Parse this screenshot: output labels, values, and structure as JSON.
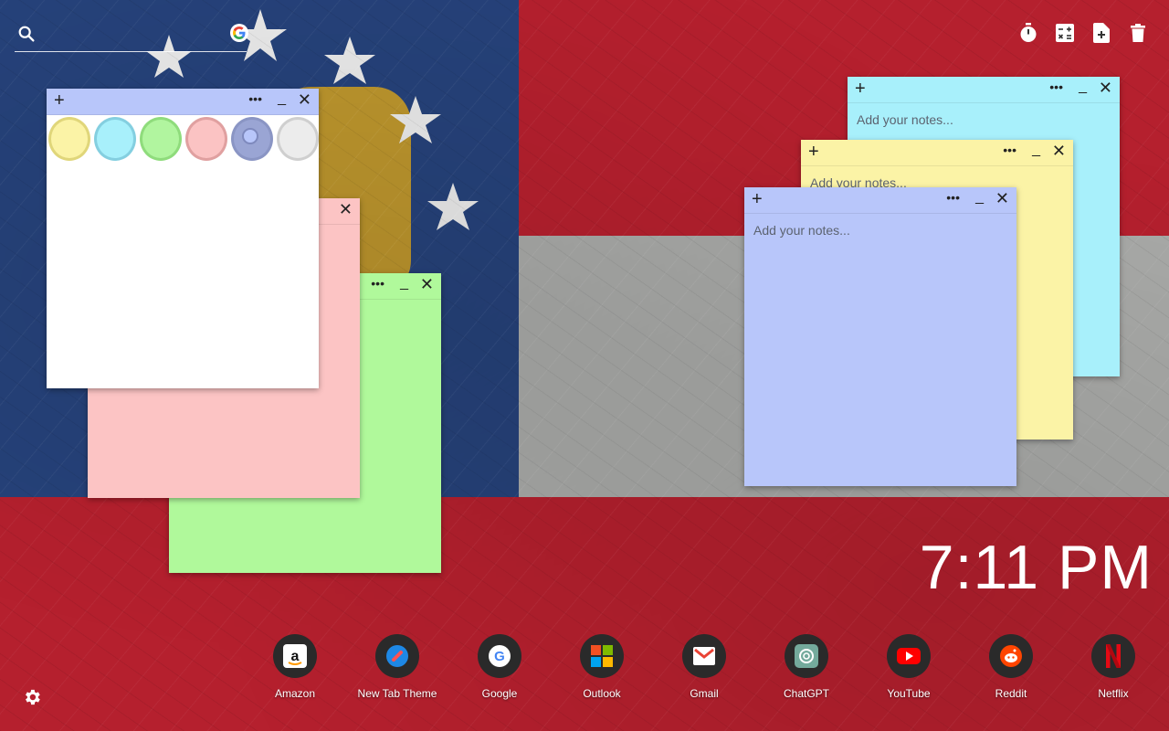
{
  "search": {
    "placeholder": "",
    "value": ""
  },
  "toolbar": {
    "icons": [
      "timer-icon",
      "calculator-icon",
      "new-note-icon",
      "trash-icon"
    ]
  },
  "palette": {
    "colors": [
      "#fbf3a6",
      "#a8f0fb",
      "#b1f59f",
      "#fbc3c3",
      "#9aa5d4",
      "#e8e8e8"
    ]
  },
  "notes": {
    "cyan": {
      "placeholder": "Add your notes...",
      "color": "#a8f0fb"
    },
    "yellow": {
      "placeholder": "Add your notes...",
      "color": "#fbf3a6"
    },
    "blue": {
      "placeholder": "Add your notes...",
      "color": "#b8c6fa"
    },
    "pink": {
      "color": "#fcc4c4"
    },
    "green": {
      "color": "#b0f99b"
    }
  },
  "clock": {
    "time": "7:11 PM"
  },
  "shortcuts": [
    {
      "label": "Amazon",
      "icon": "amazon-icon"
    },
    {
      "label": "New Tab Theme",
      "icon": "new-tab-theme-icon"
    },
    {
      "label": "Google",
      "icon": "google-icon"
    },
    {
      "label": "Outlook",
      "icon": "outlook-icon"
    },
    {
      "label": "Gmail",
      "icon": "gmail-icon"
    },
    {
      "label": "ChatGPT",
      "icon": "chatgpt-icon"
    },
    {
      "label": "YouTube",
      "icon": "youtube-icon"
    },
    {
      "label": "Reddit",
      "icon": "reddit-icon"
    },
    {
      "label": "Netflix",
      "icon": "netflix-icon"
    }
  ]
}
